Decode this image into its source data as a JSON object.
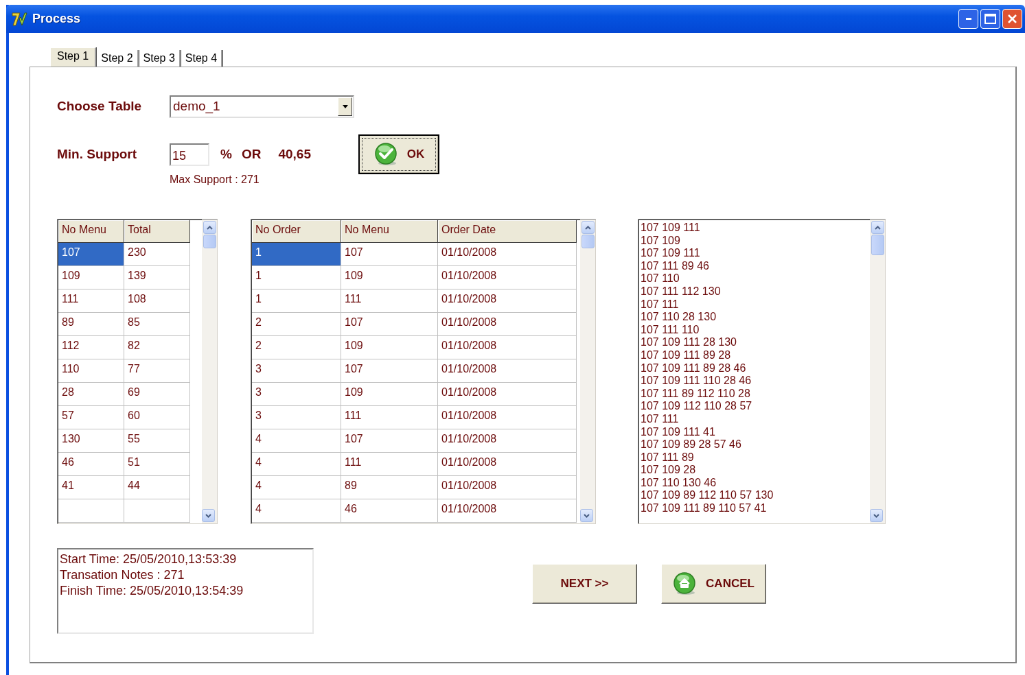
{
  "window": {
    "title": "Process"
  },
  "tabs": [
    {
      "label": "Step 1",
      "selected": true
    },
    {
      "label": "Step 2",
      "selected": false
    },
    {
      "label": "Step 3",
      "selected": false
    },
    {
      "label": "Step 4",
      "selected": false
    }
  ],
  "choose_table": {
    "label": "Choose Table",
    "value": "demo_1"
  },
  "min_support": {
    "label": "Min. Support",
    "value": "15",
    "unit": "%",
    "or_label": "OR",
    "count": "40,65",
    "max_support": "Max Support : 271"
  },
  "ok_button": {
    "label": "OK",
    "kind": "ok"
  },
  "menu_totals": {
    "columns": [
      "No Menu",
      "Total"
    ],
    "rows": [
      {
        "cells": [
          "107",
          "230"
        ],
        "selected": true
      },
      {
        "cells": [
          "109",
          "139"
        ],
        "selected": false
      },
      {
        "cells": [
          "111",
          "108"
        ],
        "selected": false
      },
      {
        "cells": [
          "89",
          "85"
        ],
        "selected": false
      },
      {
        "cells": [
          "112",
          "82"
        ],
        "selected": false
      },
      {
        "cells": [
          "110",
          "77"
        ],
        "selected": false
      },
      {
        "cells": [
          "28",
          "69"
        ],
        "selected": false
      },
      {
        "cells": [
          "57",
          "60"
        ],
        "selected": false
      },
      {
        "cells": [
          "130",
          "55"
        ],
        "selected": false
      },
      {
        "cells": [
          "46",
          "51"
        ],
        "selected": false
      },
      {
        "cells": [
          "41",
          "44"
        ],
        "selected": false
      }
    ]
  },
  "orders": {
    "columns": [
      "No Order",
      "No Menu",
      "Order Date"
    ],
    "rows": [
      {
        "cells": [
          "1",
          "107",
          "01/10/2008"
        ],
        "selected": true
      },
      {
        "cells": [
          "1",
          "109",
          "01/10/2008"
        ],
        "selected": false
      },
      {
        "cells": [
          "1",
          "111",
          "01/10/2008"
        ],
        "selected": false
      },
      {
        "cells": [
          "2",
          "107",
          "01/10/2008"
        ],
        "selected": false
      },
      {
        "cells": [
          "2",
          "109",
          "01/10/2008"
        ],
        "selected": false
      },
      {
        "cells": [
          "3",
          "107",
          "01/10/2008"
        ],
        "selected": false
      },
      {
        "cells": [
          "3",
          "109",
          "01/10/2008"
        ],
        "selected": false
      },
      {
        "cells": [
          "3",
          "111",
          "01/10/2008"
        ],
        "selected": false
      },
      {
        "cells": [
          "4",
          "107",
          "01/10/2008"
        ],
        "selected": false
      },
      {
        "cells": [
          "4",
          "111",
          "01/10/2008"
        ],
        "selected": false
      },
      {
        "cells": [
          "4",
          "89",
          "01/10/2008"
        ],
        "selected": false
      },
      {
        "cells": [
          "4",
          "46",
          "01/10/2008"
        ],
        "selected": false
      }
    ]
  },
  "itemsets": [
    "107 109 111",
    "107 109",
    "107 109 111",
    "107 111 89 46",
    "107 110",
    "107 111 112 130",
    "107 111",
    "107 110 28 130",
    "107 111 110",
    "107 109 111 28 130",
    "107 109 111 89 28",
    "107 109 111 89 28 46",
    "107 109 111 110 28 46",
    "107 111 89 112 110 28",
    "107 109 112 110 28 57",
    "107 111",
    "107 109 111 41",
    "107 109 89 28 57 46",
    "107 111 89",
    "107 109 28",
    "107 110 130 46",
    "107 109 89 112 110 57 130",
    "107 109 111 89 110 57 41"
  ],
  "log": [
    "Start Time: 25/05/2010,13:53:39",
    "Transation Notes : 271",
    "Finish Time: 25/05/2010,13:54:39"
  ],
  "buttons": [
    {
      "label": "NEXT >>",
      "kind": "next"
    },
    {
      "label": "CANCEL",
      "kind": "cancel"
    }
  ]
}
